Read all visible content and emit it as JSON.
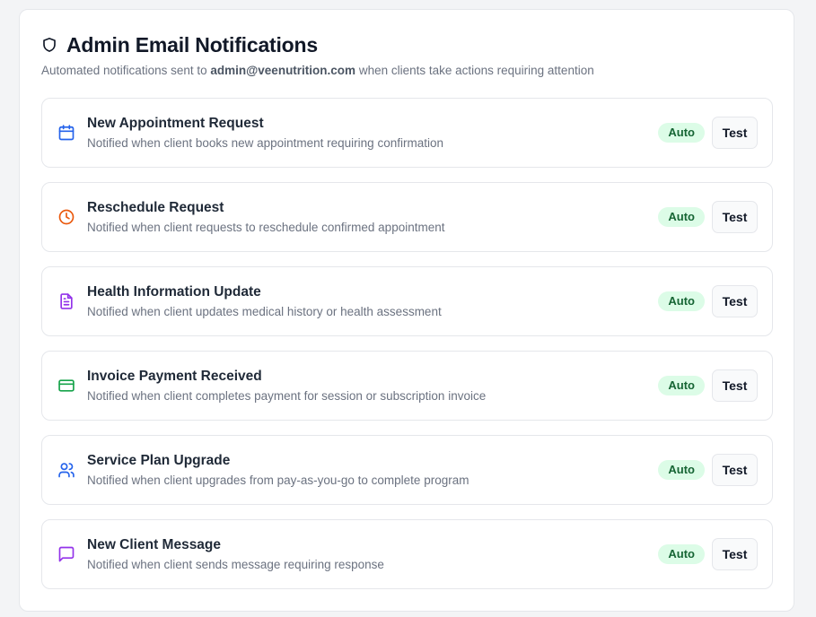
{
  "header": {
    "title": "Admin Email Notifications",
    "subtitle_prefix": "Automated notifications sent to ",
    "subtitle_email": "admin@veenutrition.com",
    "subtitle_suffix": " when clients take actions requiring attention"
  },
  "notifications": [
    {
      "title": "New Appointment Request",
      "description": "Notified when client books new appointment requiring confirmation",
      "badge": "Auto",
      "button": "Test",
      "icon": "calendar-icon",
      "color": "#2563eb"
    },
    {
      "title": "Reschedule Request",
      "description": "Notified when client requests to reschedule confirmed appointment",
      "badge": "Auto",
      "button": "Test",
      "icon": "clock-icon",
      "color": "#ea580c"
    },
    {
      "title": "Health Information Update",
      "description": "Notified when client updates medical history or health assessment",
      "badge": "Auto",
      "button": "Test",
      "icon": "document-icon",
      "color": "#9333ea"
    },
    {
      "title": "Invoice Payment Received",
      "description": "Notified when client completes payment for session or subscription invoice",
      "badge": "Auto",
      "button": "Test",
      "icon": "credit-card-icon",
      "color": "#16a34a"
    },
    {
      "title": "Service Plan Upgrade",
      "description": "Notified when client upgrades from pay-as-you-go to complete program",
      "badge": "Auto",
      "button": "Test",
      "icon": "users-icon",
      "color": "#2563eb"
    },
    {
      "title": "New Client Message",
      "description": "Notified when client sends message requiring response",
      "badge": "Auto",
      "button": "Test",
      "icon": "message-icon",
      "color": "#9333ea"
    }
  ]
}
